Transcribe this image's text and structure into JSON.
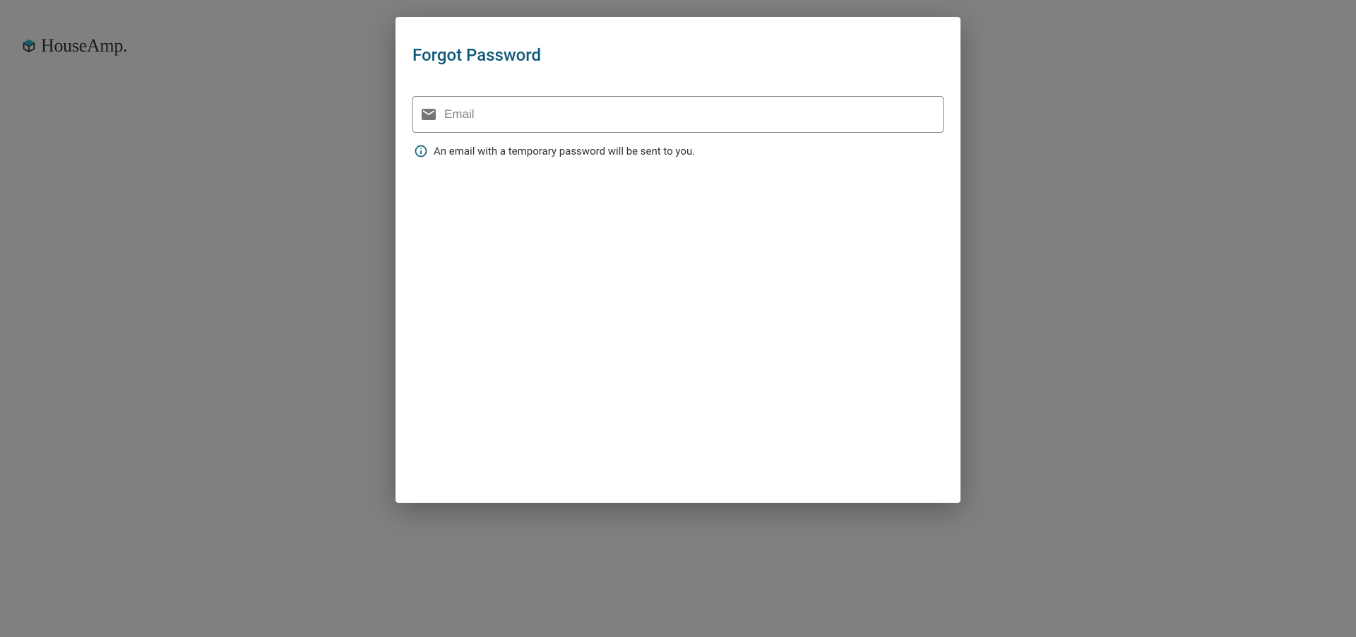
{
  "logo": {
    "text": "HouseAmp."
  },
  "modal": {
    "title": "Forgot Password",
    "email": {
      "placeholder": "Email",
      "value": ""
    },
    "info_text": "An email with a temporary password will be sent to you."
  },
  "colors": {
    "primary": "#0f5a7a",
    "overlay": "#808080",
    "text": "#333333",
    "placeholder": "#808080",
    "icon_muted": "#757575"
  }
}
